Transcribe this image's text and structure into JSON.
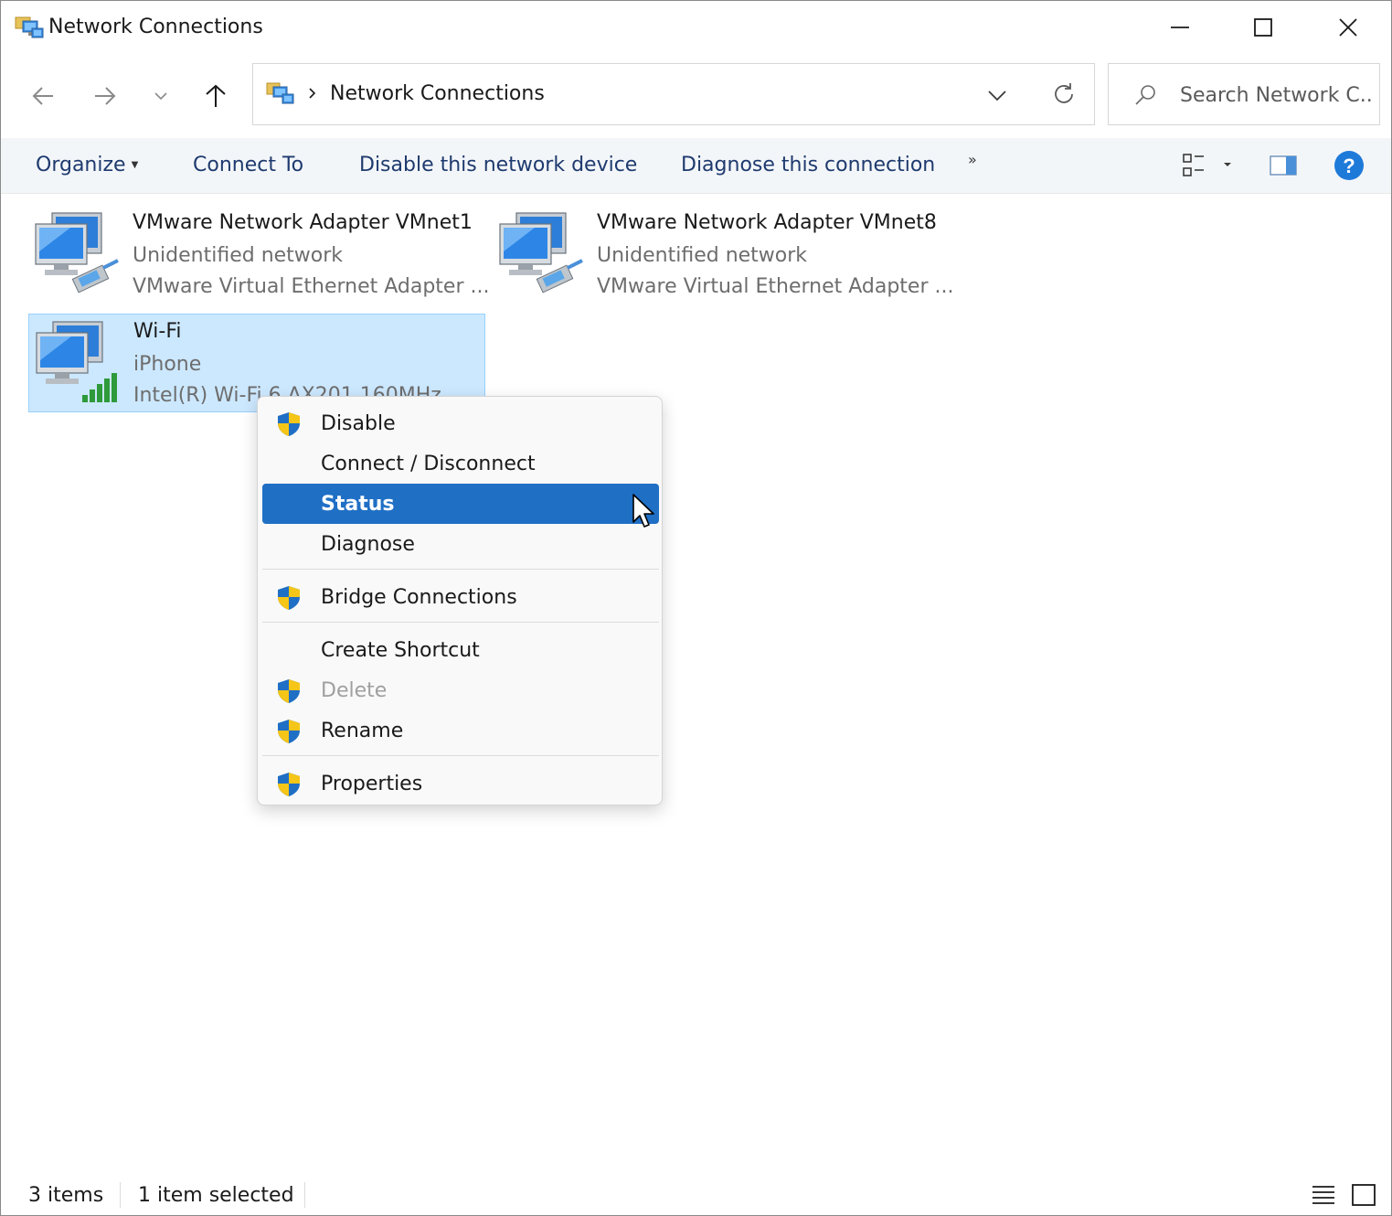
{
  "window": {
    "title": "Network Connections"
  },
  "address_bar": {
    "path": "Network Connections"
  },
  "search": {
    "placeholder": "Search Network C..."
  },
  "command_bar": {
    "organize": "Organize",
    "connect_to": "Connect To",
    "disable_device": "Disable this network device",
    "diagnose": "Diagnose this connection",
    "more": "»"
  },
  "items": [
    {
      "name": "VMware Network Adapter VMnet1",
      "status": "Unidentified network",
      "device": "VMware Virtual Ethernet Adapter ..."
    },
    {
      "name": "VMware Network Adapter VMnet8",
      "status": "Unidentified network",
      "device": "VMware Virtual Ethernet Adapter ..."
    },
    {
      "name": "Wi-Fi",
      "status": "iPhone",
      "device": "Intel(R) Wi-Fi 6 AX201 160MHz"
    }
  ],
  "context_menu": {
    "items": [
      {
        "label": "Disable",
        "shield": true,
        "state": "normal"
      },
      {
        "label": "Connect / Disconnect",
        "shield": false,
        "state": "normal"
      },
      {
        "label": "Status",
        "shield": false,
        "state": "highlighted"
      },
      {
        "label": "Diagnose",
        "shield": false,
        "state": "normal"
      },
      {
        "label": "Bridge Connections",
        "shield": true,
        "state": "normal"
      },
      {
        "label": "Create Shortcut",
        "shield": false,
        "state": "normal"
      },
      {
        "label": "Delete",
        "shield": true,
        "state": "disabled"
      },
      {
        "label": "Rename",
        "shield": true,
        "state": "normal"
      },
      {
        "label": "Properties",
        "shield": true,
        "state": "normal"
      }
    ]
  },
  "status_bar": {
    "count": "3 items",
    "selected": "1 item selected"
  },
  "colors": {
    "selection_bg": "#cce8ff",
    "menu_highlight": "#1f6fc5",
    "command_text": "#1e3a6e",
    "help_blue": "#1e7ad9"
  }
}
